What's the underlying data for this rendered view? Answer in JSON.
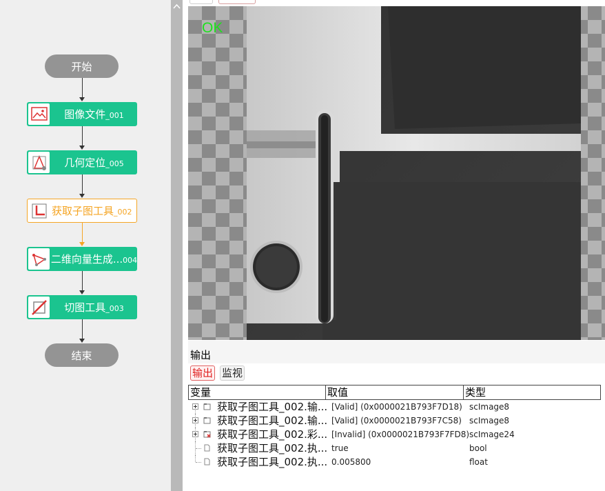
{
  "flow": {
    "start_label": "开始",
    "end_label": "结束",
    "nodes": [
      {
        "label": "图像文件",
        "suffix": "_001",
        "icon": "image-file-icon",
        "selected": false
      },
      {
        "label": "几何定位",
        "suffix": "_005",
        "icon": "geometry-locate-icon",
        "selected": false
      },
      {
        "label": "获取子图工具",
        "suffix": "_002",
        "icon": "subimage-tool-icon",
        "selected": true
      },
      {
        "label": "二维向量生成...",
        "suffix": "004",
        "icon": "vector-generate-icon",
        "selected": false
      },
      {
        "label": "切图工具",
        "suffix": "_003",
        "icon": "crop-tool-icon",
        "selected": false
      }
    ]
  },
  "viewer": {
    "status_text": "OK",
    "status_color": "#1fe01f"
  },
  "output": {
    "title": "输出",
    "tabs": {
      "output": "输出",
      "monitor": "监视"
    },
    "columns": {
      "variable": "变量",
      "value": "取值",
      "type": "类型"
    },
    "rows": [
      {
        "variable": "获取子图工具_002.输...",
        "value": "[Valid] (0x0000021B793F7D18)",
        "type": "scImage8",
        "expandable": true,
        "icon": "folder-icon"
      },
      {
        "variable": "获取子图工具_002.输...",
        "value": "[Valid] (0x0000021B793F7C58)",
        "type": "scImage8",
        "expandable": true,
        "icon": "folder-icon"
      },
      {
        "variable": "获取子图工具_002.彩...",
        "value": "[Invalid] (0x0000021B793F7FD8)",
        "type": "scImage24",
        "expandable": true,
        "icon": "invalid-folder-icon"
      },
      {
        "variable": "获取子图工具_002.执...",
        "value": "true",
        "type": "bool",
        "expandable": false,
        "icon": "document-icon"
      },
      {
        "variable": "获取子图工具_002.执...",
        "value": "0.005800",
        "type": "float",
        "expandable": false,
        "icon": "document-icon"
      }
    ]
  },
  "colors": {
    "node_green": "#1bc48f",
    "selected_orange": "#f5a524",
    "terminal_gray": "#949494"
  }
}
